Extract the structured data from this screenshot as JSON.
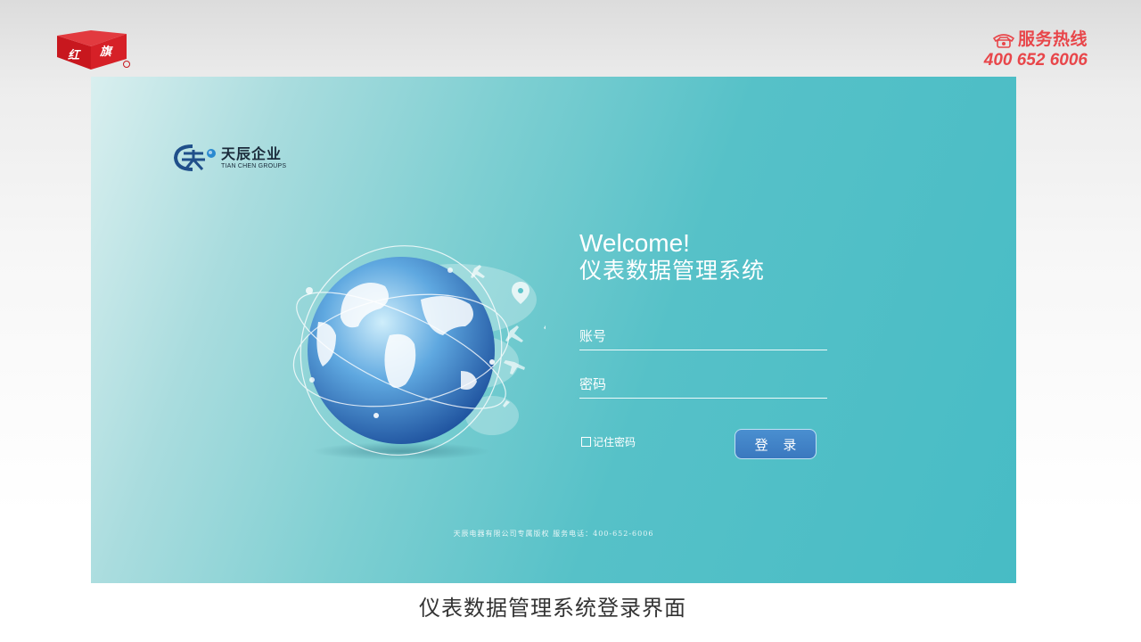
{
  "header": {
    "brand_logo_icon": "hongqi-logo-icon",
    "hotline_title": "服务热线",
    "hotline_number": "400 652 6006",
    "accent_color": "#e8464a"
  },
  "panel": {
    "company_cn": "天辰企业",
    "company_en": "TIAN CHEN GROUPS",
    "welcome": "Welcome!",
    "system_name": "仪表数据管理系统",
    "username_placeholder": "账号",
    "password_placeholder": "密码",
    "remember_label": "记住密码",
    "login_label": "登 录",
    "copyright": "天辰电器有限公司专属版权  服务电话：400-652-6006",
    "button_color": "#3a78bf"
  },
  "caption": "仪表数据管理系统登录界面"
}
